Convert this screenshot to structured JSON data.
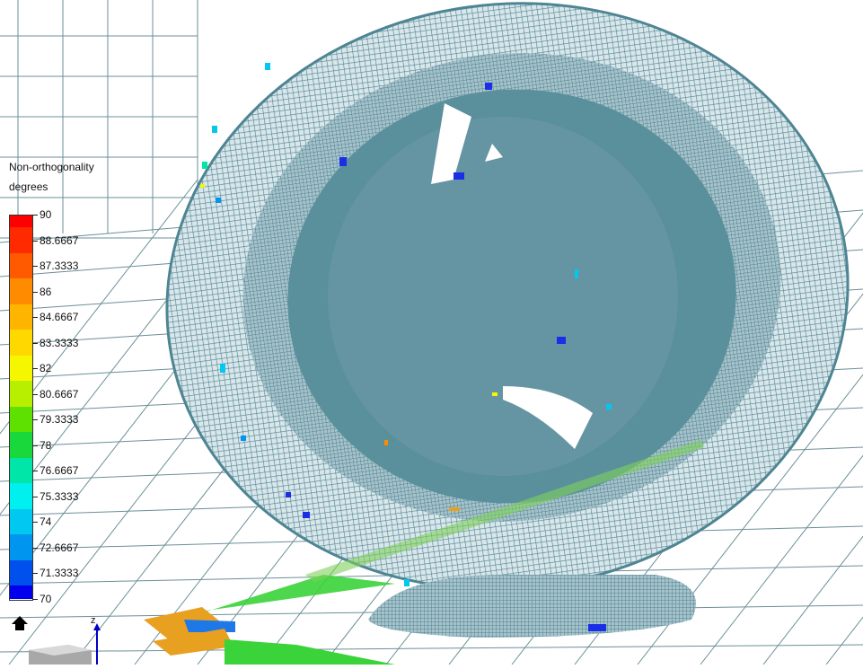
{
  "legend": {
    "title": "Non-orthogonality",
    "units": "degrees",
    "labels": [
      "90",
      "88.6667",
      "87.3333",
      "86",
      "84.6667",
      "83.3333",
      "82",
      "80.6667",
      "79.3333",
      "78",
      "76.6667",
      "75.3333",
      "74",
      "72.6667",
      "71.3333",
      "70"
    ],
    "colors": [
      "#ff0000",
      "#ff2a00",
      "#ff5a00",
      "#ff8c00",
      "#ffb400",
      "#ffd800",
      "#f6f600",
      "#b8ef00",
      "#5ee000",
      "#18d83c",
      "#00e6a8",
      "#00f0f0",
      "#00c8f0",
      "#0096f0",
      "#0050ee",
      "#0000ee"
    ]
  },
  "axes": {
    "z_label": "z"
  },
  "colors": {
    "mesh": "#4e8593",
    "mesh_fill": "#5a8f9c",
    "grid": "#6c8f99"
  }
}
